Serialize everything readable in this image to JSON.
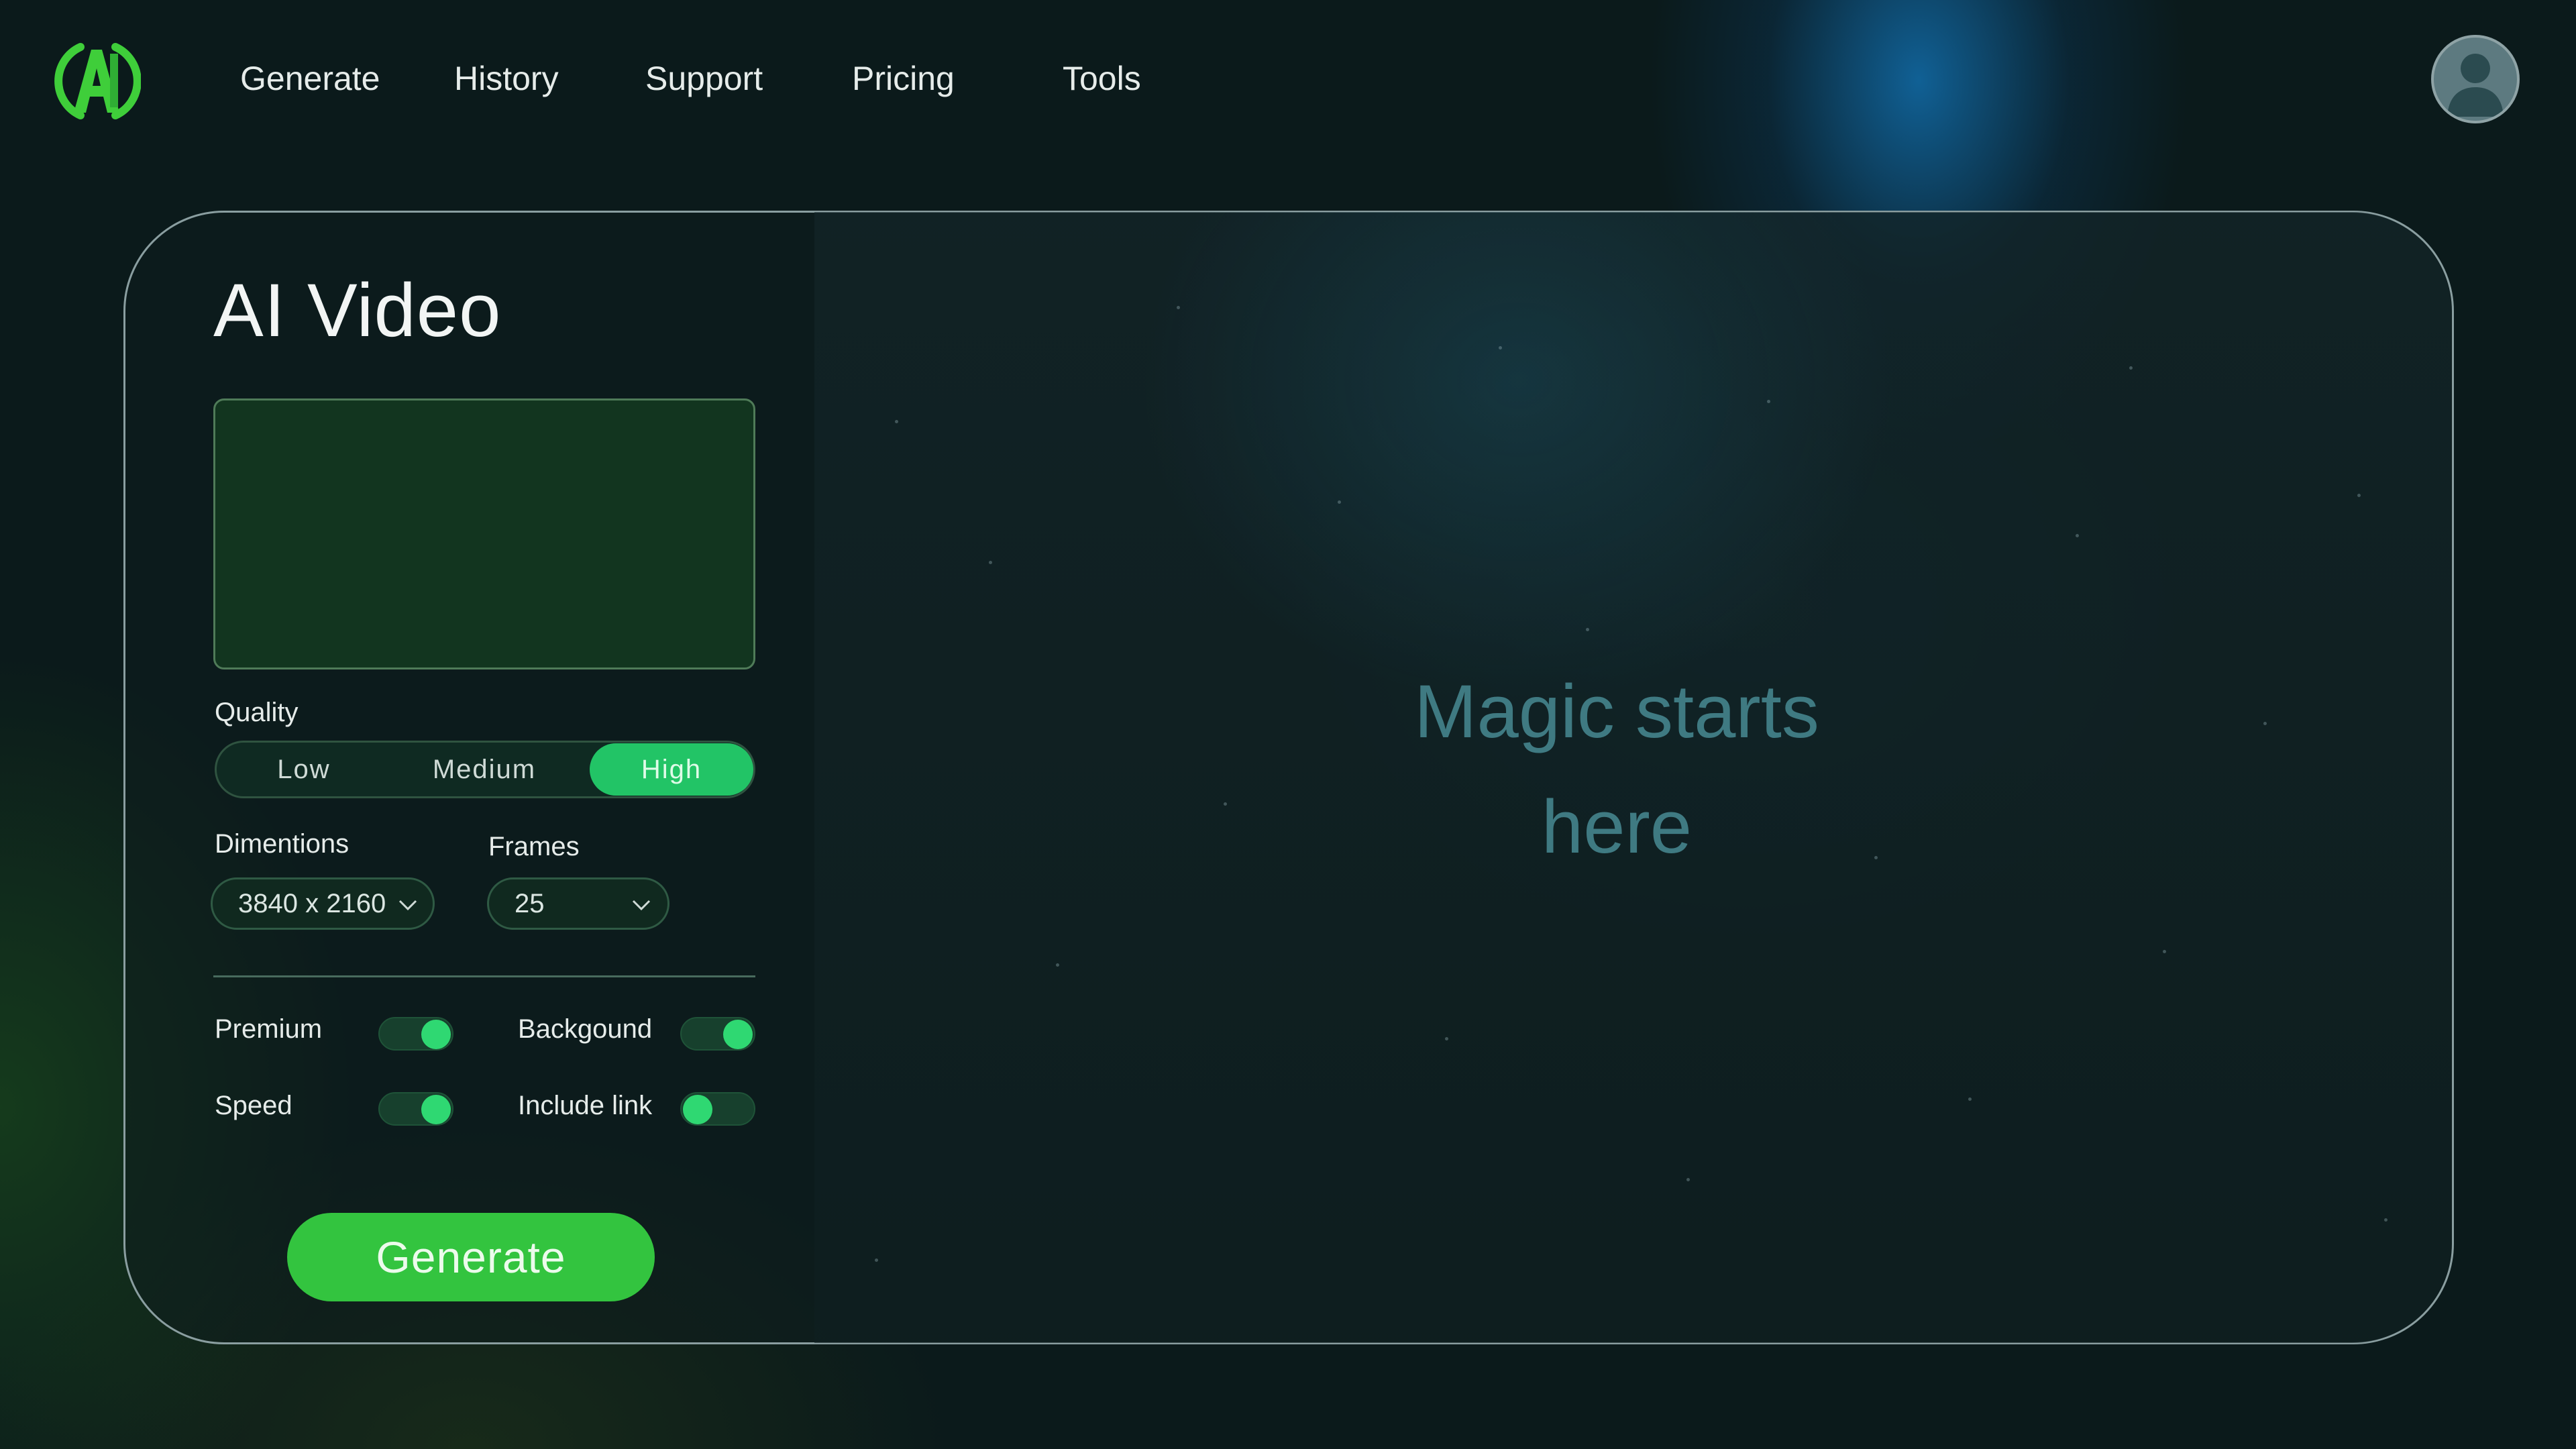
{
  "colors": {
    "accent": "#22c466",
    "button": "#33c43f",
    "panel_border": "#8a9ea0",
    "hint_text": "#3f7a82",
    "logo_green": "#3fce3a"
  },
  "header": {
    "logo_icon": "ai-logo-icon",
    "nav": [
      {
        "label": "Generate"
      },
      {
        "label": "History"
      },
      {
        "label": "Support"
      },
      {
        "label": "Pricing"
      },
      {
        "label": "Tools"
      }
    ],
    "avatar_icon": "user-avatar-icon"
  },
  "main": {
    "title": "AI Video",
    "quality": {
      "label": "Quality",
      "options": [
        "Low",
        "Medium",
        "High"
      ],
      "selected": "High"
    },
    "dimensions": {
      "label": "Dimentions",
      "value": "3840 x 2160"
    },
    "frames": {
      "label": "Frames",
      "value": "25"
    },
    "toggles": [
      {
        "label": "Premium",
        "on": true
      },
      {
        "label": "Backgound",
        "on": true
      },
      {
        "label": "Speed",
        "on": true
      },
      {
        "label": "Include link",
        "on": false
      }
    ],
    "generate_label": "Generate"
  },
  "preview": {
    "line1": "Magic starts",
    "line2": "here"
  }
}
